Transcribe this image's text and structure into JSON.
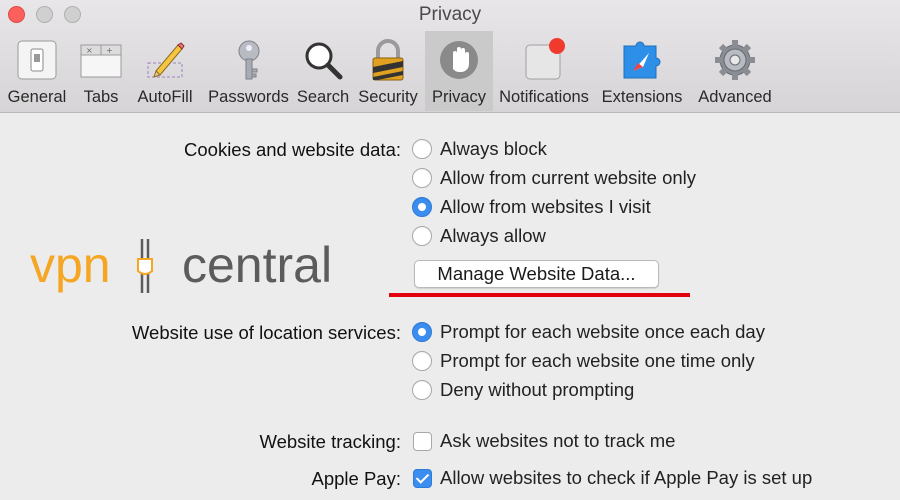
{
  "window": {
    "title": "Privacy"
  },
  "toolbar": {
    "items": [
      {
        "label": "General",
        "icon": "general-switch-icon",
        "selected": false
      },
      {
        "label": "Tabs",
        "icon": "tabs-icon",
        "selected": false
      },
      {
        "label": "AutoFill",
        "icon": "pencil-icon",
        "selected": false
      },
      {
        "label": "Passwords",
        "icon": "key-icon",
        "selected": false
      },
      {
        "label": "Search",
        "icon": "magnifier-icon",
        "selected": false
      },
      {
        "label": "Security",
        "icon": "padlock-icon",
        "selected": false
      },
      {
        "label": "Privacy",
        "icon": "hand-icon",
        "selected": true
      },
      {
        "label": "Notifications",
        "icon": "notification-badge-icon",
        "selected": false
      },
      {
        "label": "Extensions",
        "icon": "puzzle-compass-icon",
        "selected": false
      },
      {
        "label": "Advanced",
        "icon": "gear-icon",
        "selected": false
      }
    ]
  },
  "cookies": {
    "label": "Cookies and website data:",
    "options": [
      {
        "label": "Always block",
        "checked": false
      },
      {
        "label": "Allow from current website only",
        "checked": false
      },
      {
        "label": "Allow from websites I visit",
        "checked": true
      },
      {
        "label": "Always allow",
        "checked": false
      }
    ],
    "manage_button": "Manage Website Data..."
  },
  "location": {
    "label": "Website use of location services:",
    "options": [
      {
        "label": "Prompt for each website once each day",
        "checked": true
      },
      {
        "label": "Prompt for each website one time only",
        "checked": false
      },
      {
        "label": "Deny without prompting",
        "checked": false
      }
    ]
  },
  "tracking": {
    "label": "Website tracking:",
    "option": "Ask websites not to track me",
    "checked": false
  },
  "applepay": {
    "label": "Apple Pay:",
    "option": "Allow websites to check if Apple Pay is set up",
    "checked": true
  },
  "watermark": {
    "part1": "vpn",
    "part2": "central"
  },
  "colors": {
    "accent": "#3b8ef0",
    "highlight_line": "#e3000f",
    "logo_orange": "#f5a623",
    "logo_gray": "#5c5c5c"
  }
}
